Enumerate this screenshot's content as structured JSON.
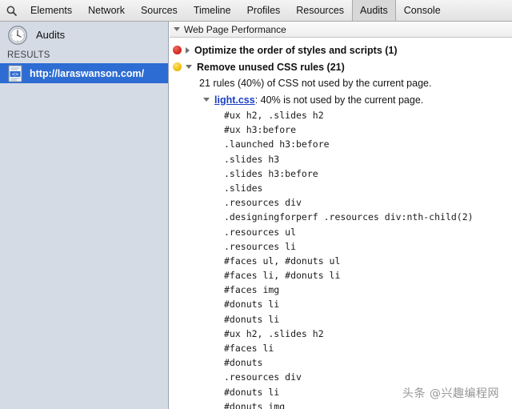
{
  "toolbar": {
    "search_icon": "search-icon",
    "tabs": [
      {
        "label": "Elements",
        "active": false
      },
      {
        "label": "Network",
        "active": false
      },
      {
        "label": "Sources",
        "active": false
      },
      {
        "label": "Timeline",
        "active": false
      },
      {
        "label": "Profiles",
        "active": false
      },
      {
        "label": "Resources",
        "active": false
      },
      {
        "label": "Audits",
        "active": true
      },
      {
        "label": "Console",
        "active": false
      }
    ]
  },
  "sidebar": {
    "panel_icon": "clock-icon",
    "panel_title": "Audits",
    "results_label": "RESULTS",
    "result": {
      "icon": "document-code-icon",
      "url": "http://laraswanson.com/",
      "selected": true
    }
  },
  "main": {
    "section": {
      "disclosure": "triangle-down-icon",
      "title": "Web Page Performance"
    },
    "audits": [
      {
        "severity": "red",
        "disclosure": "triangle-right-icon",
        "label": "Optimize the order of styles and scripts (1)",
        "expanded": false
      },
      {
        "severity": "yellow",
        "disclosure": "triangle-down-icon",
        "label": "Remove unused CSS rules (21)",
        "expanded": true
      }
    ],
    "detail_text": "21 rules (40%) of CSS not used by the current page.",
    "file": {
      "disclosure": "triangle-down-icon",
      "name": "light.css",
      "rest": ": 40% is not used by the current page."
    },
    "selectors": [
      "#ux h2, .slides h2",
      "#ux h3:before",
      ".launched h3:before",
      ".slides h3",
      ".slides h3:before",
      ".slides",
      ".resources div",
      ".designingforperf .resources div:nth-child(2)",
      ".resources ul",
      ".resources li",
      "#faces ul, #donuts ul",
      "#faces li, #donuts li",
      "#faces img",
      "#donuts li",
      "#donuts li",
      "#ux h2, .slides h2",
      "#faces li",
      "#donuts",
      ".resources div",
      "#donuts li",
      "#donuts img"
    ]
  },
  "watermark": {
    "text": "头条 @兴趣编程网"
  },
  "colors": {
    "accent_selection": "#2d6cd2",
    "sidebar_bg": "#d5dbe5",
    "severity_error": "#d42c23",
    "severity_warning": "#f0c10e",
    "link": "#1a3fc4"
  }
}
